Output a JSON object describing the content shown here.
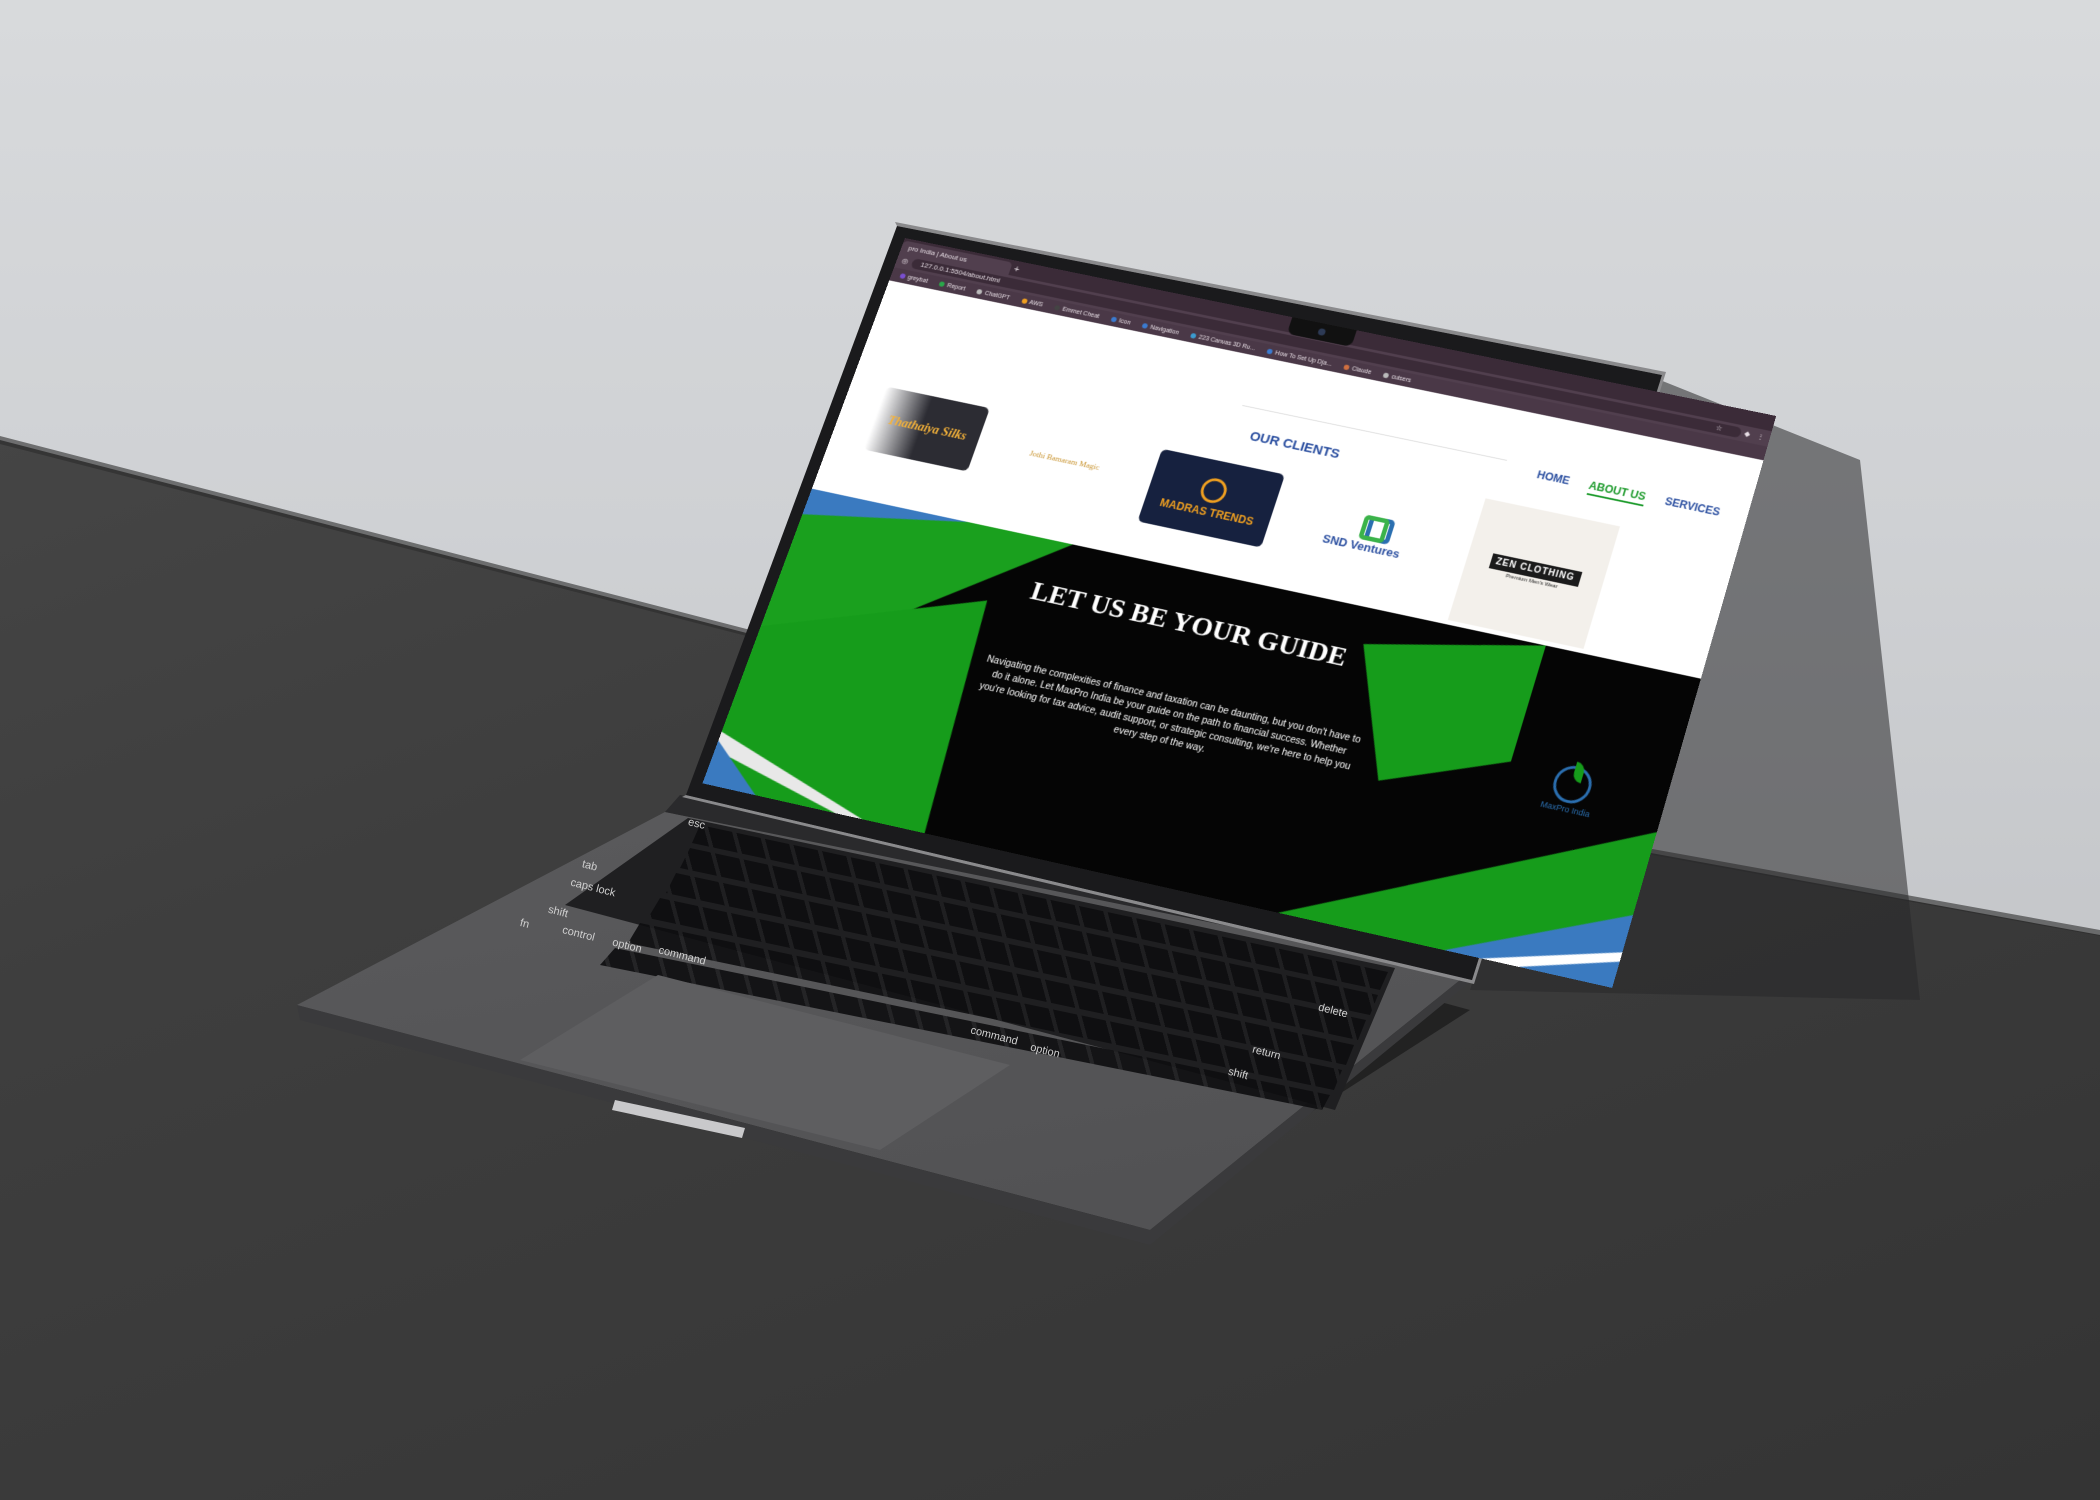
{
  "browser": {
    "tab_title": "pro India | About us",
    "new_tab": "+",
    "url": "127.0.0.1:5504/about.html",
    "star_icon": "star-icon",
    "bookmarks": [
      {
        "label": "greybat",
        "color": "#7a4fd0"
      },
      {
        "label": "Report",
        "color": "#2aa84a"
      },
      {
        "label": "ChatGPT",
        "color": "#bbbbbb"
      },
      {
        "label": "AWS",
        "color": "#f0a020"
      },
      {
        "label": "Emmet Cheat",
        "color": "#444444"
      },
      {
        "label": "Icon",
        "color": "#3b7bd0"
      },
      {
        "label": "Navigation",
        "color": "#3b7bd0"
      },
      {
        "label": "223 Canvas 3D Ru...",
        "color": "#3b9bd0"
      },
      {
        "label": "How To Set Up Dja...",
        "color": "#3b7bd0"
      },
      {
        "label": "Claude",
        "color": "#d07040"
      },
      {
        "label": "cuisers",
        "color": "#bbbbbb"
      }
    ]
  },
  "nav": {
    "links": [
      "HOME",
      "ABOUT US",
      "SERVICES"
    ],
    "active": "ABOUT US"
  },
  "clients": {
    "title": "OUR CLIENTS",
    "logos": [
      "Thathaiya Silks",
      "Jothi Bamaram Magic",
      "MADRAS TRENDS",
      "SND Ventures",
      "ZEN CLOTHING"
    ],
    "zen_tagline": "Premium Men's Wear"
  },
  "hero": {
    "title": "LET US BE YOUR GUIDE",
    "text": "Navigating the complexities of finance and taxation can be daunting, but you don't have to do it alone. Let MaxPro India be your guide on the path to financial success. Whether you're looking for tax advice, audit support, or strategic consulting, we're here to help you every step of the way.",
    "logo_name": "MaxPro India"
  },
  "keyboard": {
    "labels": [
      "esc",
      "tab",
      "caps lock",
      "shift",
      "fn",
      "control",
      "option",
      "command",
      "command",
      "option",
      "delete",
      "return",
      "shift"
    ]
  },
  "colors": {
    "brand_blue": "#2b4fa0",
    "brand_green": "#1b9a2a",
    "browser_chrome": "#3b2b38"
  }
}
